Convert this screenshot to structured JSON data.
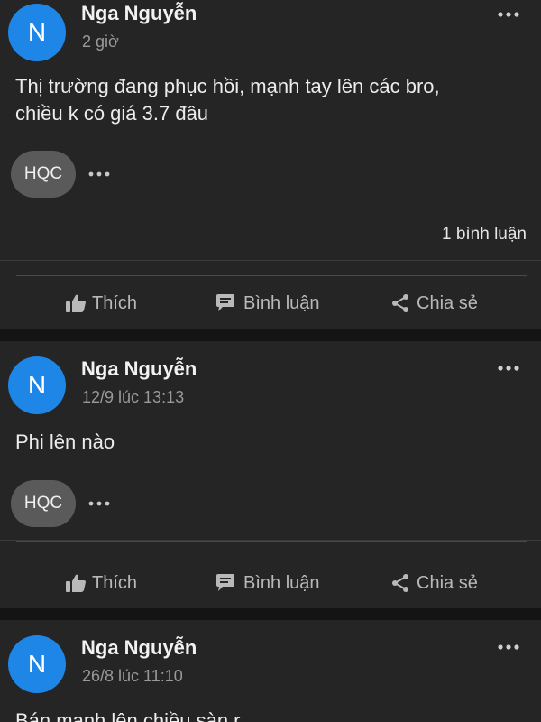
{
  "colors": {
    "background": "#141414",
    "card": "#252525",
    "avatar": "#1d86e6",
    "tag": "#5a5a5a",
    "muted_text": "#9a9a9a",
    "action_text": "#b9b9b9"
  },
  "icons": {
    "more": "more-horizontal-icon",
    "like": "thumbs-up-icon",
    "comment": "comment-bubble-icon",
    "share": "share-icon"
  },
  "action_labels": {
    "like": "Thích",
    "comment": "Bình luận",
    "share": "Chia sẻ"
  },
  "posts": [
    {
      "avatar_letter": "N",
      "author": "Nga Nguyễn",
      "time": "2 giờ",
      "content": "Thị trường đang phục hồi, mạnh tay lên các bro,\nchiều k có giá 3.7 đâu",
      "tag": "HQC",
      "comment_count": "1 bình luận"
    },
    {
      "avatar_letter": "N",
      "author": "Nga Nguyễn",
      "time": "12/9 lúc 13:13",
      "content": "Phi lên nào",
      "tag": "HQC"
    },
    {
      "avatar_letter": "N",
      "author": "Nga Nguyễn",
      "time": "26/8 lúc 11:10",
      "content": "Bán mạnh lên chiều sàn r"
    }
  ]
}
